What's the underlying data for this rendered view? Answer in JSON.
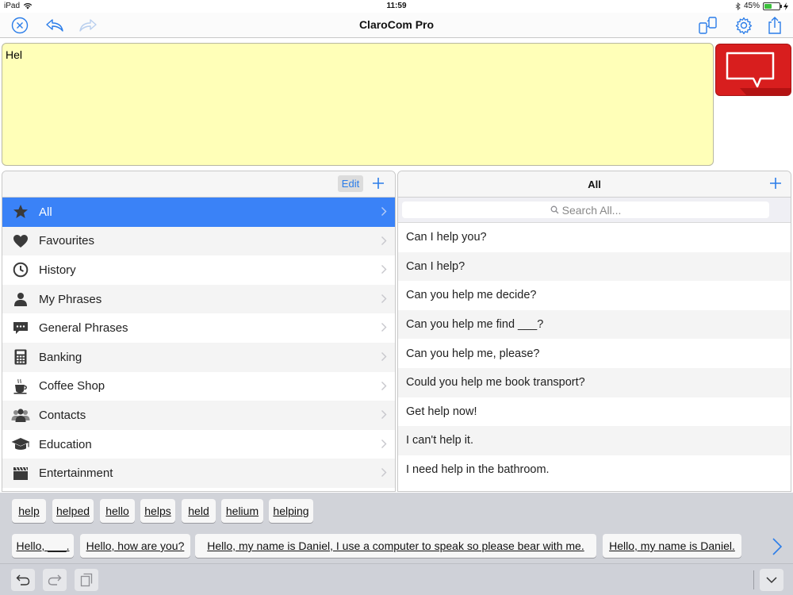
{
  "status_bar": {
    "device": "iPad",
    "time": "11:59",
    "battery": "45%"
  },
  "app": {
    "title": "ClaroCom Pro"
  },
  "editor": {
    "text": "Hel"
  },
  "categories": {
    "edit_label": "Edit",
    "items": [
      {
        "label": "All",
        "icon": "star-icon"
      },
      {
        "label": "Favourites",
        "icon": "heart-icon"
      },
      {
        "label": "History",
        "icon": "clock-icon"
      },
      {
        "label": "My Phrases",
        "icon": "person-icon"
      },
      {
        "label": "General Phrases",
        "icon": "speech-bubble-icon"
      },
      {
        "label": "Banking",
        "icon": "calculator-icon"
      },
      {
        "label": "Coffee Shop",
        "icon": "coffee-cup-icon"
      },
      {
        "label": "Contacts",
        "icon": "contacts-icon"
      },
      {
        "label": "Education",
        "icon": "graduation-cap-icon"
      },
      {
        "label": "Entertainment",
        "icon": "clapperboard-icon"
      }
    ]
  },
  "phrases": {
    "title": "All",
    "search_placeholder": "Search All...",
    "items": [
      "Can I help you?",
      "Can I help?",
      "Can you help me decide?",
      "Can you help me find ___?",
      "Can you help me, please?",
      "Could you help me book transport?",
      "Get help now!",
      "I can't help it.",
      "I need help in the bathroom."
    ]
  },
  "predictions": {
    "words": [
      "help",
      "helped",
      "hello",
      "helps",
      "held",
      "helium",
      "helping"
    ],
    "sentences": [
      "Hello, ___.",
      "Hello, how are you?",
      "Hello, my name is Daniel, I use a computer to speak so please bear with me.",
      "Hello, my name is Daniel."
    ]
  },
  "colors": {
    "accent": "#3a82f7",
    "editor_bg": "#ffffb8",
    "speak": "#d81e1e"
  }
}
